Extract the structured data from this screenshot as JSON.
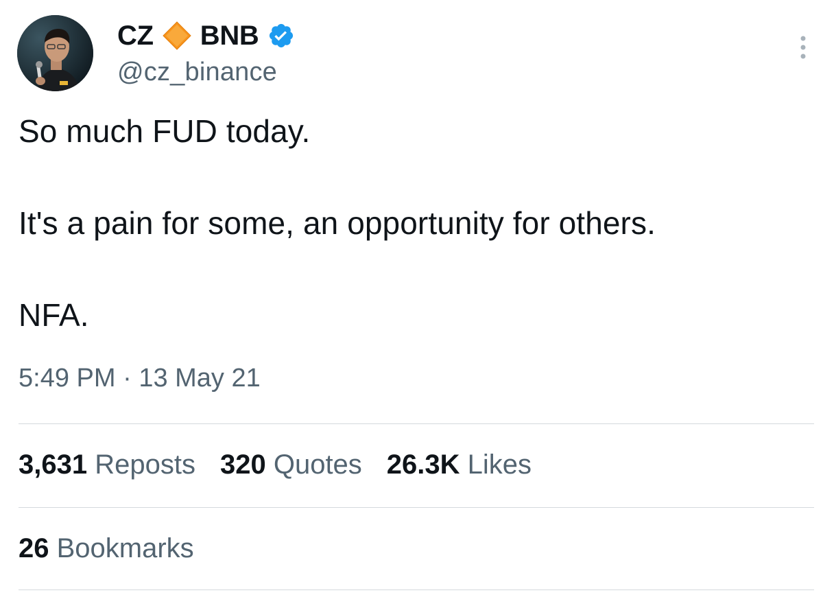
{
  "author": {
    "name_first": "CZ",
    "name_second": "BNB",
    "handle": "@cz_binance",
    "avatar_icon": "profile-photo",
    "diamond_icon": "orange-diamond-icon",
    "verified_icon": "verified-badge-icon",
    "verified_color": "#1d9bf0",
    "diamond_color": "#f7941d"
  },
  "tweet": {
    "lines": [
      "So much FUD today.",
      "It's a pain for some, an opportunity for others.",
      "NFA."
    ],
    "time": "5:49 PM",
    "separator": " · ",
    "date": "13 May 21"
  },
  "stats": {
    "reposts_count": "3,631",
    "reposts_label": " Reposts",
    "quotes_count": "320",
    "quotes_label": " Quotes",
    "likes_count": "26.3K",
    "likes_label": " Likes",
    "bookmarks_count": "26",
    "bookmarks_label": " Bookmarks"
  },
  "colors": {
    "text_primary": "#0f1419",
    "text_secondary": "#536471",
    "divider": "#d4d9dd"
  },
  "menu": {
    "more_icon": "more-vertical-icon"
  }
}
